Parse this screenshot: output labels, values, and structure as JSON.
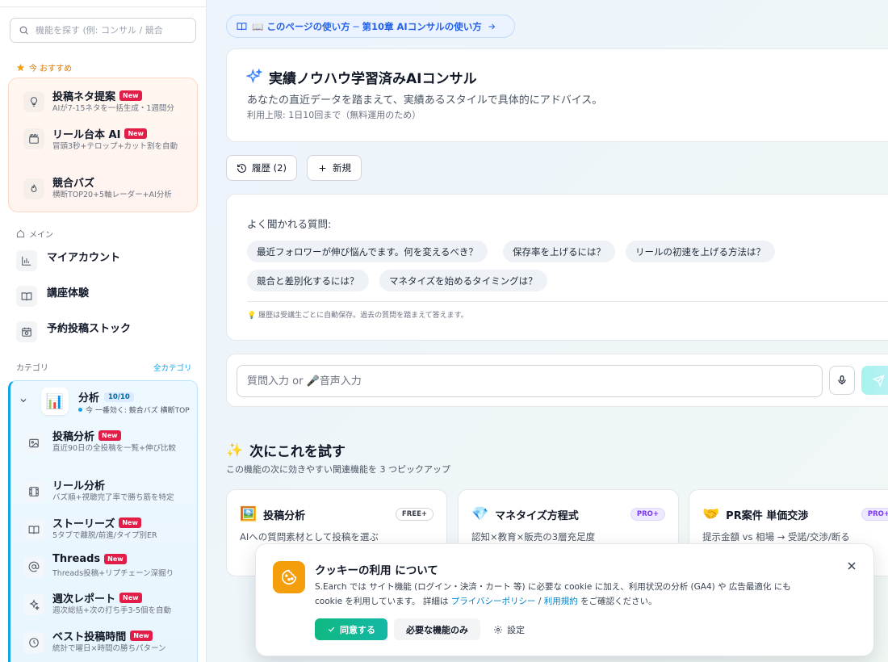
{
  "sidebar": {
    "search_placeholder": "機能を探す (例: コンサル / 競合",
    "recommend_label": "今 おすすめ",
    "recommended": [
      {
        "title": "投稿ネタ提案",
        "badge": "New",
        "desc": "AIが7-15ネタを一括生成・1週間分",
        "icon": "lightbulb-icon"
      },
      {
        "title": "リール台本 AI",
        "badge": "New",
        "desc": "冒頭3秒+テロップ+カット割を自動",
        "icon": "clapperboard-icon"
      },
      {
        "title": "競合バズ",
        "badge": "",
        "desc": "横断TOP20+5軸レーダー+AI分析",
        "icon": "flame-icon"
      }
    ],
    "main_label": "メイン",
    "main_items": [
      {
        "label": "マイアカウント",
        "icon": "bar-chart-icon"
      },
      {
        "label": "講座体験",
        "icon": "book-open-icon"
      },
      {
        "label": "予約投稿ストック",
        "icon": "calendar-clock-icon"
      }
    ],
    "category_label": "カテゴリ",
    "all_categories": "全カテゴリ",
    "category": {
      "emoji": "📊",
      "title": "分析",
      "count": "10/10",
      "subtitle": "今 一番効く: 競合バズ 横断TOP",
      "items": [
        {
          "title": "投稿分析",
          "badge": "New",
          "desc": "直近90日の全投稿を一覧+伸び比較",
          "icon": "image-icon"
        },
        {
          "title": "リール分析",
          "badge": "",
          "desc": "バズ順+視聴完了率で勝ち筋を特定",
          "icon": "film-icon"
        },
        {
          "title": "ストーリーズ",
          "badge": "New",
          "desc": "5タブで離脱/前進/タイプ別ER",
          "icon": "book-icon"
        },
        {
          "title": "Threads",
          "badge": "New",
          "desc": "Threads投稿+リプチェーン深掘り",
          "icon": "at-sign-icon"
        },
        {
          "title": "週次レポート",
          "badge": "New",
          "desc": "週次総括+次の打ち手3-5個を自動",
          "icon": "sparkles-icon"
        },
        {
          "title": "ベスト投稿時間",
          "badge": "New",
          "desc": "統計で曜日×時間の勝ちパターン",
          "icon": "clock-icon"
        }
      ]
    }
  },
  "main": {
    "howto": "📖 このページの使い方 ─ 第10章 AIコンサルの使い方",
    "hero": {
      "title": "実績ノウハウ学習済みAIコンサル",
      "desc": "あなたの直近データを踏まえて、実績あるスタイルで具体的にアドバイス。",
      "limit": "利用上限: 1日10回まで（無料運用のため）"
    },
    "history_button": "履歴 (2)",
    "new_button": "新規",
    "faq": {
      "title": "よく聞かれる質問:",
      "chips": [
        "最近フォロワーが伸び悩んでます。何を変えるべき？",
        "保存率を上げるには？",
        "リールの初速を上げる方法は？",
        "競合と差別化するには？",
        "マネタイズを始めるタイミングは？"
      ],
      "note": "履歴は受講生ごとに自動保存。過去の質問を踏まえて答えます。"
    },
    "input_placeholder": "質問入力 or 🎤音声入力",
    "next": {
      "title": "次にこれを試す",
      "subtitle": "この機能の次に効きやすい関連機能を 3 つピックアップ",
      "tiles": [
        {
          "emoji": "🖼️",
          "title": "投稿分析",
          "badge": "FREE+",
          "desc": "AIへの質問素材として投稿を選ぶ"
        },
        {
          "emoji": "💎",
          "title": "マネタイズ方程式",
          "badge": "PRO+",
          "desc": "認知×教育×販売の3層充足度"
        },
        {
          "emoji": "🤝",
          "title": "PR案件 単価交渉",
          "badge": "PRO+",
          "desc": "提示金額 vs 相場 → 受諾/交渉/断る"
        }
      ]
    }
  },
  "cookie": {
    "title": "クッキーの利用 について",
    "body_1": "S.Earch では サイト機能 (ログイン・決済・カート 等) に必要な cookie に加え、利用状況の分析 (GA4) や 広告最適化 にも cookie を利用しています。 詳細は ",
    "privacy_link": "プライバシーポリシー",
    "sep": " / ",
    "terms_link": "利用規約",
    "body_2": " をご確認ください。",
    "accept": "同意する",
    "necessary_only": "必要な機能のみ",
    "settings": "設定"
  },
  "colors": {
    "accent": "#0ea5e9",
    "new_badge": "#e11d48",
    "cookie_icon": "#f59e0b",
    "accept": "#10b981"
  }
}
